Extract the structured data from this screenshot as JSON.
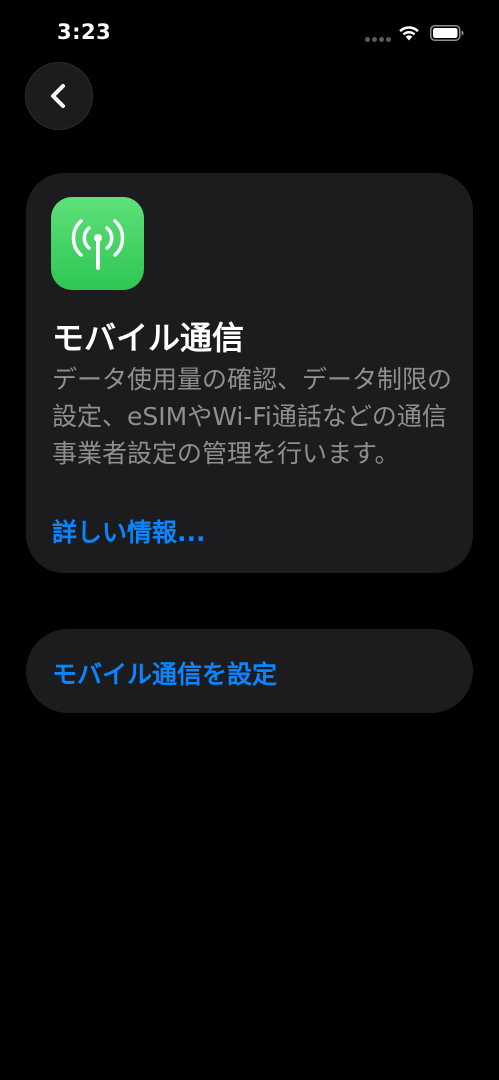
{
  "status_bar": {
    "time": "3:23",
    "icons": [
      "signal-dots-icon",
      "wifi-icon",
      "battery-icon"
    ]
  },
  "nav": {
    "back_icon": "chevron-left-icon"
  },
  "card": {
    "icon": "cellular-antenna-icon",
    "title": "モバイル通信",
    "description": "データ使用量の確認、データ制限の設定、eSIMやWi-Fi通話などの通信事業者設定の管理を行います。",
    "learn_more": "詳しい情報..."
  },
  "setup": {
    "label": "モバイル通信を設定"
  },
  "colors": {
    "background": "#000000",
    "card": "#1c1c1e",
    "accent": "#0a84ff",
    "icon_green": "#34c759",
    "secondary_text": "#8e8e93"
  }
}
